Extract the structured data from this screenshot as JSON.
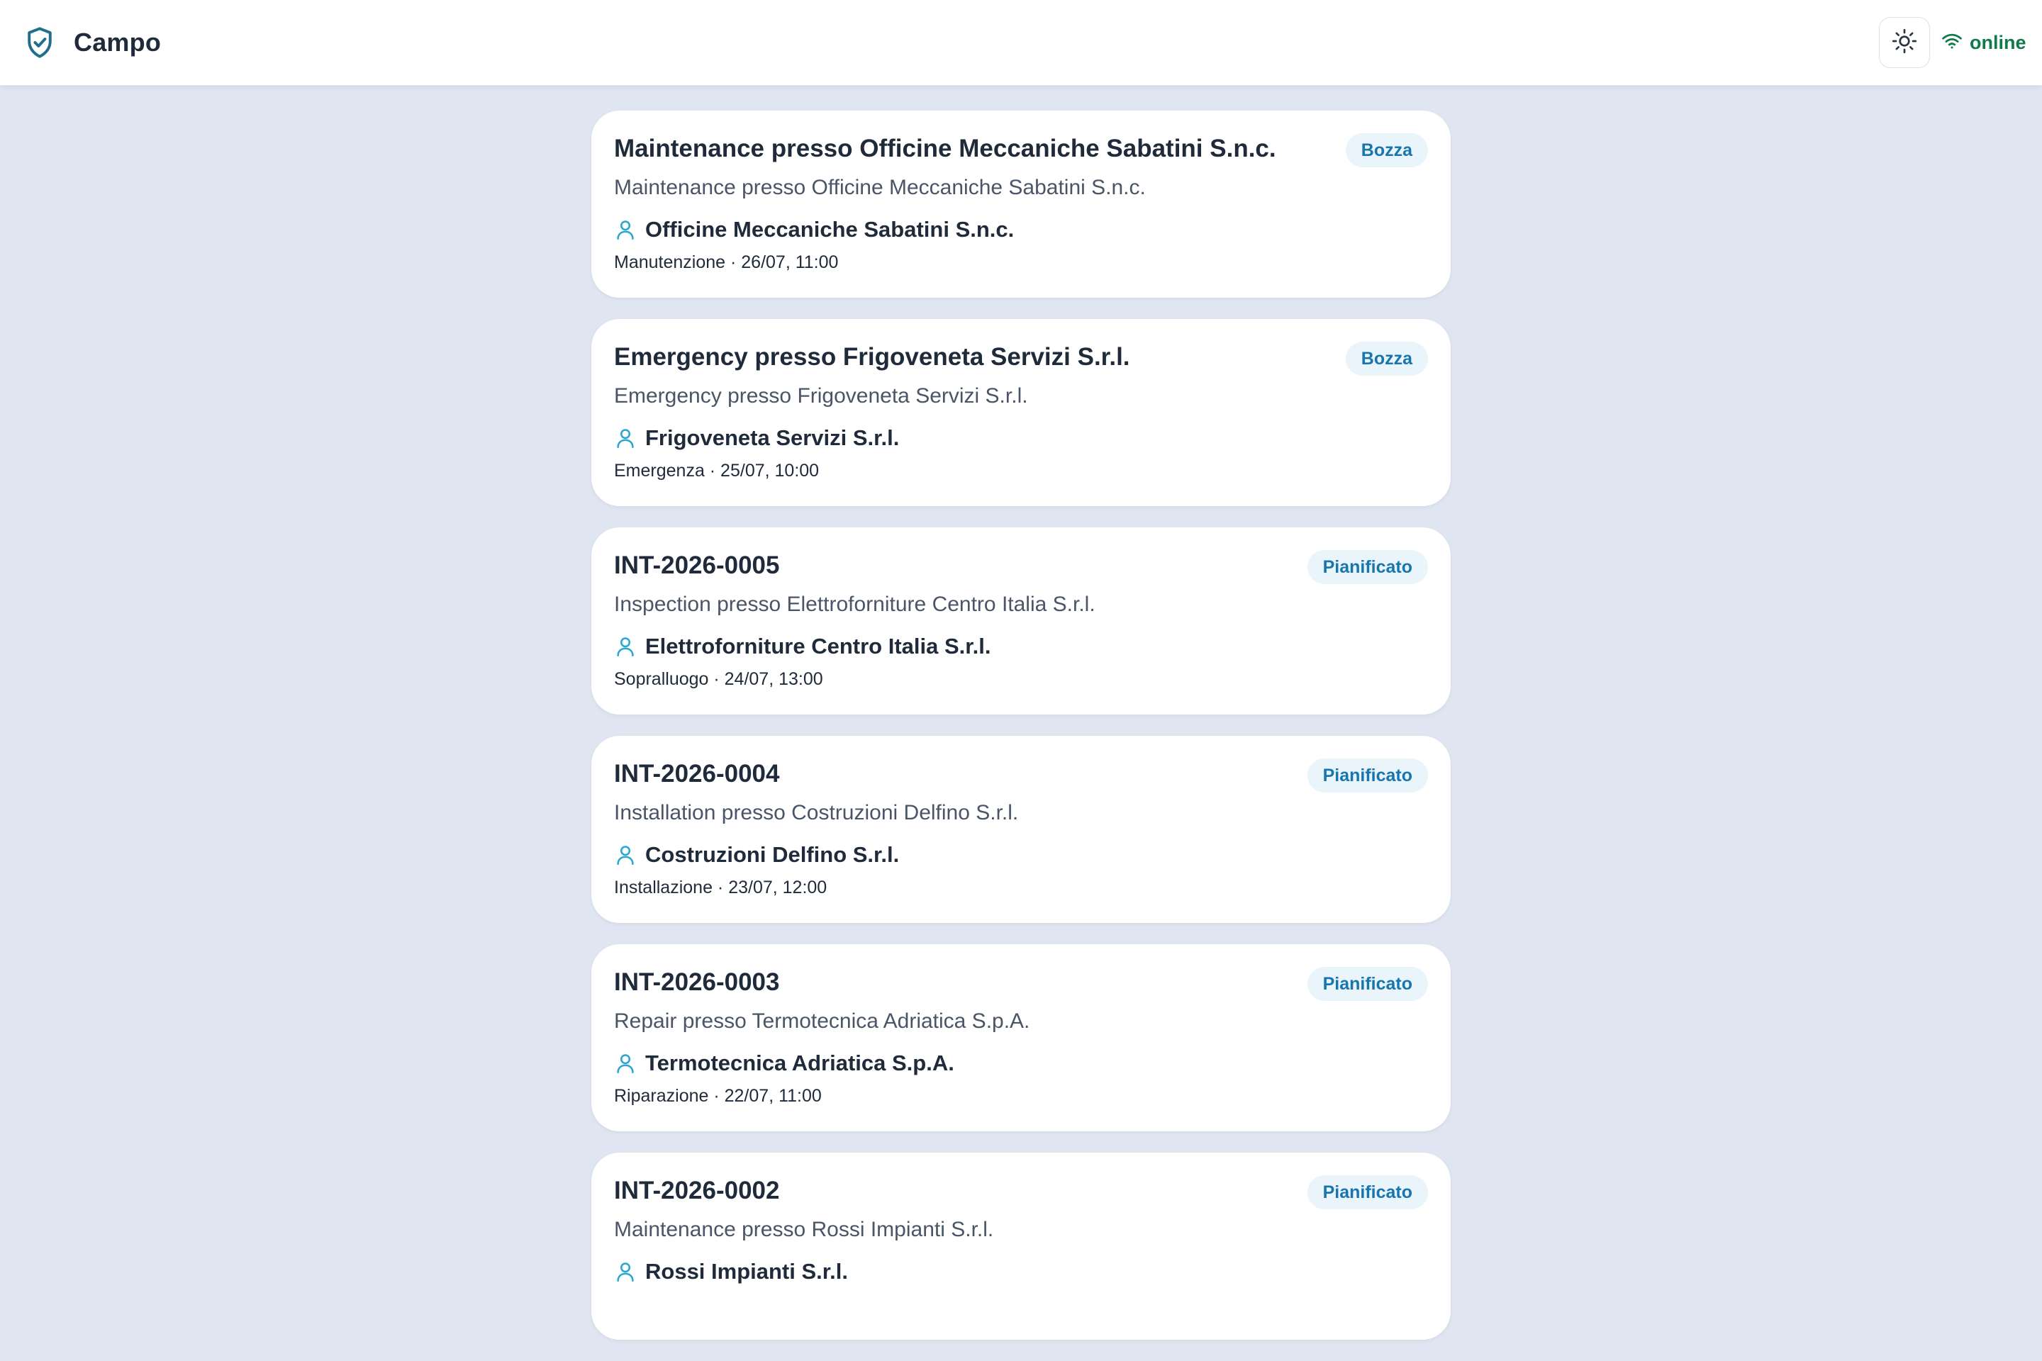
{
  "app": {
    "title": "Campo",
    "brand_icon": "shield-check-icon",
    "theme_toggle_icon": "sun-icon",
    "status_icon": "wifi-icon",
    "status_label": "online",
    "status_color": "#0f7a4a",
    "accent_color": "#1976ad"
  },
  "interventions": [
    {
      "title": "Maintenance presso Officine Meccaniche Sabatini S.n.c.",
      "status": "Bozza",
      "description": "Maintenance presso Officine Meccaniche Sabatini S.n.c.",
      "client": "Officine Meccaniche Sabatini S.n.c.",
      "meta": "Manutenzione · 26/07, 11:00"
    },
    {
      "title": "Emergency presso Frigoveneta Servizi S.r.l.",
      "status": "Bozza",
      "description": "Emergency presso Frigoveneta Servizi S.r.l.",
      "client": "Frigoveneta Servizi S.r.l.",
      "meta": "Emergenza · 25/07, 10:00"
    },
    {
      "title": "INT-2026-0005",
      "status": "Pianificato",
      "description": "Inspection presso Elettroforniture Centro Italia S.r.l.",
      "client": "Elettroforniture Centro Italia S.r.l.",
      "meta": "Sopralluogo · 24/07, 13:00"
    },
    {
      "title": "INT-2026-0004",
      "status": "Pianificato",
      "description": "Installation presso Costruzioni Delfino S.r.l.",
      "client": "Costruzioni Delfino S.r.l.",
      "meta": "Installazione · 23/07, 12:00"
    },
    {
      "title": "INT-2026-0003",
      "status": "Pianificato",
      "description": "Repair presso Termotecnica Adriatica S.p.A.",
      "client": "Termotecnica Adriatica S.p.A.",
      "meta": "Riparazione · 22/07, 11:00"
    },
    {
      "title": "INT-2026-0002",
      "status": "Pianificato",
      "description": "Maintenance presso Rossi Impianti S.r.l.",
      "client": "Rossi Impianti S.r.l.",
      "meta": ""
    }
  ]
}
